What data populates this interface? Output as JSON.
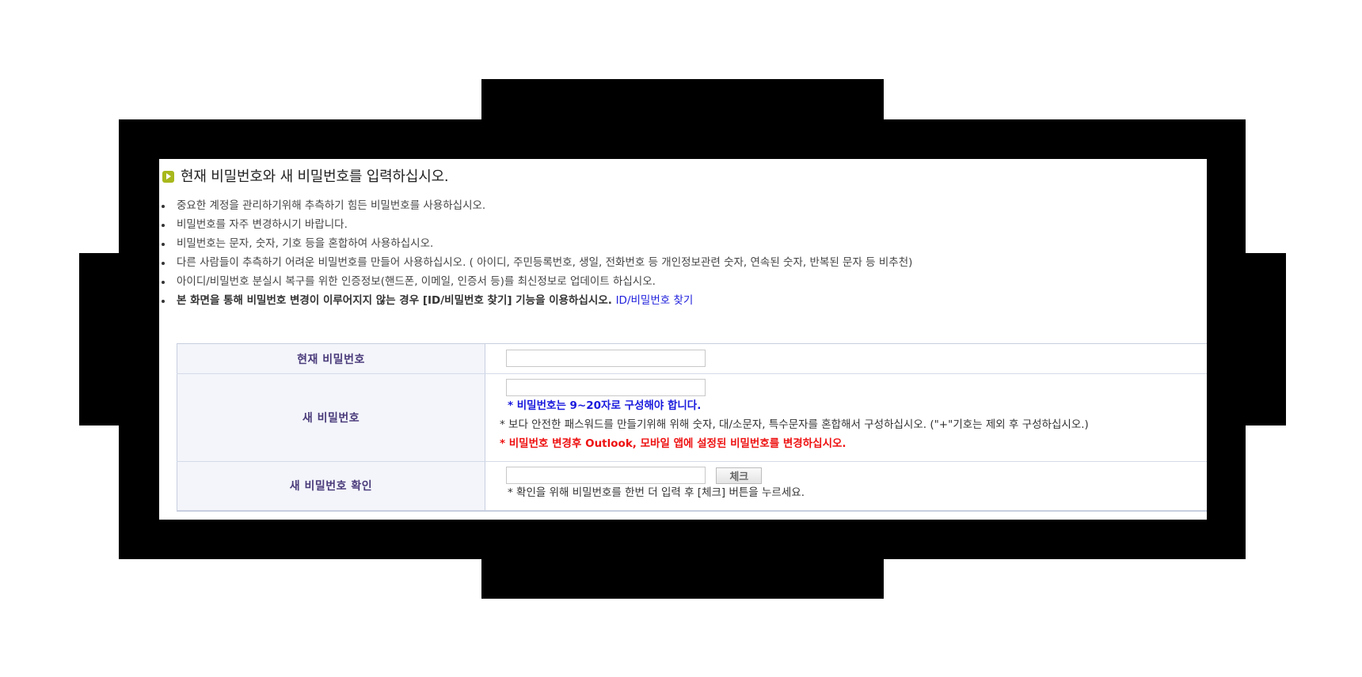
{
  "heading": "현재 비밀번호와 새 비밀번호를 입력하십시오.",
  "notes": [
    "중요한 계정을 관리하기위해 추측하기 힘든 비밀번호를 사용하십시오.",
    "비밀번호를 자주 변경하시기 바랍니다.",
    "비밀번호는 문자, 숫자, 기호 등을 혼합하여 사용하십시오.",
    "다른 사람들이 추측하기 어려운 비밀번호를 만들어 사용하십시오. ( 아이디, 주민등록번호, 생일, 전화번호 등 개인정보관련 숫자, 연속된 숫자, 반복된 문자 등 비추천)",
    "아이디/비밀번호 분실시 복구를 위한 인증정보(핸드폰, 이메일, 인증서 등)를 최신정보로 업데이트 하십시오."
  ],
  "important_note": {
    "text": "본 화면을 통해 비밀번호 변경이 이루어지지 않는 경우 [ID/비밀번호 찾기] 기능을 이용하십시오.",
    "link": "ID/비밀번호 찾기"
  },
  "form": {
    "current_password_label": "현재 비밀번호",
    "new_password_label": "새 비밀번호",
    "new_password_hint_length": "* 비밀번호는 9~20자로 구성해야 합니다.",
    "new_password_hint_mix": "* 보다 안전한 패스워드를 만들기위해 위해 숫자, 대/소문자, 특수문자를 혼합해서 구성하십시오. (\"+\"기호는 제외 후 구성하십시오.)",
    "new_password_hint_outlook": "* 비밀번호 변경후 Outlook, 모바일 앱에 설정된 비밀번호를 변경하십시오.",
    "confirm_label": "새 비밀번호 확인",
    "check_button": "체크",
    "confirm_hint": "* 확인을 위해 비밀번호를 한번 더 입력 후 [체크] 버튼을 누르세요."
  },
  "colors": {
    "accent_icon": "#a8b81c",
    "label_text": "#4a3a7a",
    "link": "#2222dd",
    "warning": "#ee1111"
  }
}
